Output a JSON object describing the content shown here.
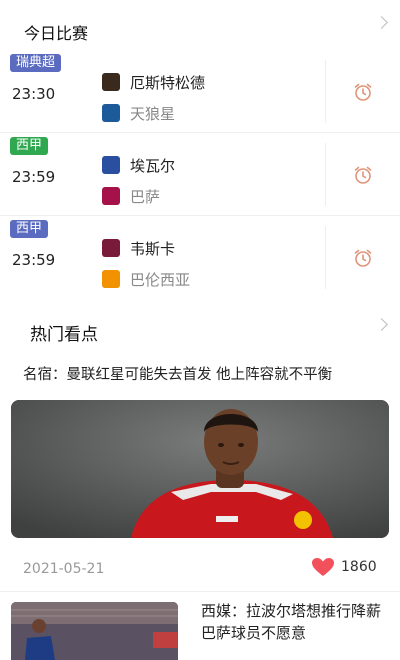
{
  "today": {
    "title": "今日比赛",
    "matches": [
      {
        "league": "瑞典超",
        "league_color": "#5b6bbf",
        "time": "23:30",
        "home": "厄斯特松德",
        "away": "天狼星",
        "home_color": "#3a2a1e",
        "away_color": "#1c5a9a"
      },
      {
        "league": "西甲",
        "league_color": "#2fa84f",
        "time": "23:59",
        "home": "埃瓦尔",
        "away": "巴萨",
        "home_color": "#2a4ea0",
        "away_color": "#a5124a"
      },
      {
        "league": "西甲",
        "league_color": "#5b6bbf",
        "time": "23:59",
        "home": "韦斯卡",
        "away": "巴伦西亚",
        "home_color": "#7a1a3a",
        "away_color": "#f29200"
      }
    ]
  },
  "hot": {
    "title": "热门看点",
    "headline": "名宿：曼联红星可能失去首发 他上阵容就不平衡",
    "date": "2021-05-21",
    "likes": "1860",
    "second_title": "西媒：拉波尔塔想推行降薪 巴萨球员不愿意"
  },
  "colors": {
    "alarm": "#e0957a",
    "heart": "#f2505a"
  }
}
